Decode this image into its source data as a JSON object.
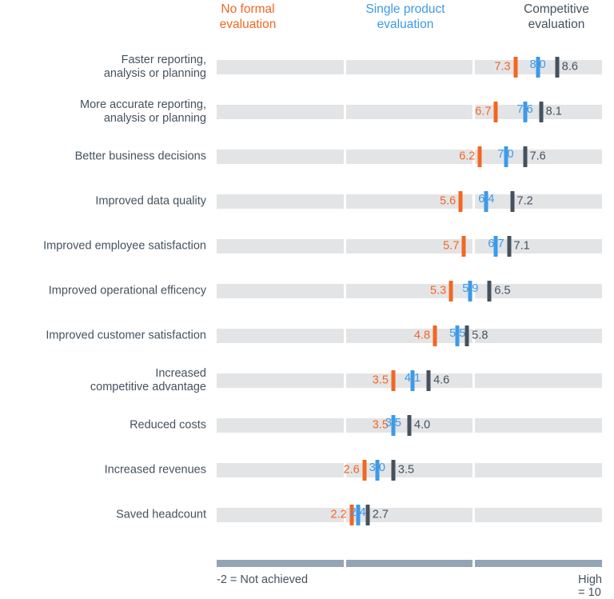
{
  "chart_data": {
    "type": "bar",
    "title": "",
    "subtitle": "",
    "xlabel": "",
    "ylabel": "",
    "xlim": [
      -2,
      10
    ],
    "grid": false,
    "legend_position": "top",
    "axis_min_label": "-2 = Not achieved",
    "axis_max_label": "High = 10",
    "series": [
      {
        "name": "No formal evaluation",
        "color": "#f26722",
        "values": [
          7.3,
          6.7,
          6.2,
          5.6,
          5.7,
          5.3,
          4.8,
          3.5,
          3.5,
          2.6,
          2.2
        ]
      },
      {
        "name": "Single product evaluation",
        "color": "#3d9ae8",
        "values": [
          8.0,
          7.6,
          7.0,
          6.4,
          6.7,
          5.9,
          5.5,
          4.1,
          3.5,
          3.0,
          2.4
        ]
      },
      {
        "name": "Competitive evaluation",
        "color": "#45525e",
        "values": [
          8.6,
          8.1,
          7.6,
          7.2,
          7.1,
          6.5,
          5.8,
          4.6,
          4.0,
          3.5,
          2.7
        ]
      }
    ],
    "categories": [
      "Faster reporting, analysis or planning",
      "More accurate reporting, analysis or planning",
      "Better business decisions",
      "Improved data quality",
      "Improved employee satisfaction",
      "Improved operational efficency",
      "Improved customer satisfaction",
      "Increased competitive advantage",
      "Reduced costs",
      "Increased revenues",
      "Saved headcount"
    ]
  },
  "legend": {
    "items": [
      {
        "line1": "No formal",
        "line2": "evaluation",
        "color": "#f26722"
      },
      {
        "line1": "Single product",
        "line2": "evaluation",
        "color": "#3d9ae8"
      },
      {
        "line1": "Competitive",
        "line2": "evaluation",
        "color": "#45525e"
      }
    ]
  },
  "rows": [
    {
      "label_line1": "Faster reporting,",
      "label_line2": "analysis or planning",
      "no_formal": "7.3",
      "single_product": "8.0",
      "competitive": "8.6"
    },
    {
      "label_line1": "More accurate reporting,",
      "label_line2": "analysis or planning",
      "no_formal": "6.7",
      "single_product": "7.6",
      "competitive": "8.1"
    },
    {
      "label_line1": "Better business decisions",
      "label_line2": "",
      "no_formal": "6.2",
      "single_product": "7.0",
      "competitive": "7.6"
    },
    {
      "label_line1": "Improved data quality",
      "label_line2": "",
      "no_formal": "5.6",
      "single_product": "6.4",
      "competitive": "7.2"
    },
    {
      "label_line1": "Improved employee satisfaction",
      "label_line2": "",
      "no_formal": "5.7",
      "single_product": "6.7",
      "competitive": "7.1"
    },
    {
      "label_line1": "Improved operational efficency",
      "label_line2": "",
      "no_formal": "5.3",
      "single_product": "5.9",
      "competitive": "6.5"
    },
    {
      "label_line1": "Improved customer satisfaction",
      "label_line2": "",
      "no_formal": "4.8",
      "single_product": "5.5",
      "competitive": "5.8"
    },
    {
      "label_line1": "Increased",
      "label_line2": "competitive advantage",
      "no_formal": "3.5",
      "single_product": "4.1",
      "competitive": "4.6"
    },
    {
      "label_line1": "Reduced costs",
      "label_line2": "",
      "no_formal": "3.5",
      "single_product": "3.5",
      "competitive": "4.0"
    },
    {
      "label_line1": "Increased revenues",
      "label_line2": "",
      "no_formal": "2.6",
      "single_product": "3.0",
      "competitive": "3.5"
    },
    {
      "label_line1": "Saved headcount",
      "label_line2": "",
      "no_formal": "2.2",
      "single_product": "2.4",
      "competitive": "2.7"
    }
  ],
  "footer": {
    "min_label": "-2 = Not achieved",
    "max_label": "High = 10"
  }
}
